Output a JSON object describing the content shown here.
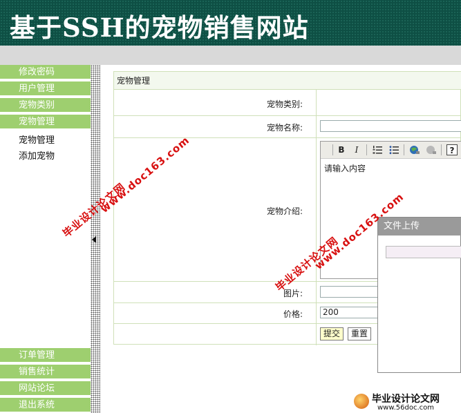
{
  "header": {
    "title": "基于SSH的宠物销售网站"
  },
  "sidebar": {
    "top_items": [
      {
        "label": "修改密码"
      },
      {
        "label": "用户管理"
      },
      {
        "label": "宠物类别"
      },
      {
        "label": "宠物管理"
      }
    ],
    "sub_items": [
      {
        "label": "宠物管理"
      },
      {
        "label": "添加宠物"
      }
    ],
    "bottom_items": [
      {
        "label": "订单管理"
      },
      {
        "label": "销售统计"
      },
      {
        "label": "网站论坛"
      },
      {
        "label": "退出系统"
      }
    ]
  },
  "form": {
    "heading": "宠物管理",
    "category_label": "宠物类别:",
    "name_label": "宠物名称:",
    "name_value": "",
    "intro_label": "宠物介绍:",
    "intro_placeholder": "请输入内容",
    "image_label": "图片:",
    "image_value": "",
    "price_label": "价格:",
    "price_value": "200",
    "submit_label": "提交",
    "reset_label": "重置"
  },
  "editor_toolbar": {
    "bold": "B",
    "italic": "I",
    "help": "?"
  },
  "upload_dialog": {
    "title": "文件上传"
  },
  "watermarks": {
    "site_name": "毕业设计论文网",
    "site_url": "www.doc163.com"
  },
  "logo": {
    "name": "毕业设计论文网",
    "url": "www.56doc.com"
  }
}
